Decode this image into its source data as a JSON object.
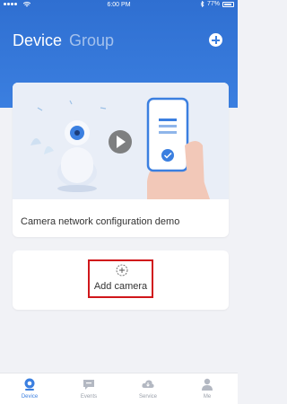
{
  "status_bar": {
    "carrier": "",
    "time": "6:00 PM",
    "battery": "77%"
  },
  "header": {
    "tabs": [
      {
        "label": "Device",
        "active": true
      },
      {
        "label": "Group",
        "active": false
      }
    ],
    "add_icon": "plus-circle-icon"
  },
  "demo_card": {
    "label": "Camera network configuration demo",
    "image_icons": [
      "camera-icon",
      "play-icon",
      "phone-icon",
      "checkmark-icon"
    ]
  },
  "add_card": {
    "icon": "add-camera-icon",
    "label": "Add camera"
  },
  "tabbar": {
    "items": [
      {
        "label": "Device",
        "icon": "device-icon",
        "active": true
      },
      {
        "label": "Events",
        "icon": "events-icon",
        "active": false
      },
      {
        "label": "Service",
        "icon": "service-icon",
        "active": false
      },
      {
        "label": "Me",
        "icon": "me-icon",
        "active": false
      }
    ]
  },
  "colors": {
    "primary": "#3b7fe0",
    "header_bg": "#2f6fd1",
    "highlight_border": "#d0171b",
    "inactive_tab": "#9aa0aa"
  }
}
